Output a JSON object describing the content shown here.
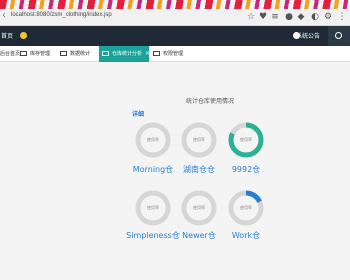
{
  "browser": {
    "url": "localhost:8080/zsm_clothing/index.jsp"
  },
  "header": {
    "brand": "首页",
    "user": "系统公告"
  },
  "tabs": [
    {
      "label": "后台首页"
    },
    {
      "label": "库存管理"
    },
    {
      "label": "数据统计"
    },
    {
      "label": "仓库统计分析",
      "active": true
    },
    {
      "label": "权限管理"
    }
  ],
  "panel": {
    "title": "统计仓库使用情况",
    "detail_link": "详细"
  },
  "warehouses": [
    {
      "name": "Morning仓",
      "label": "使用率",
      "usage": 0.0
    },
    {
      "name": "湖南仓仓",
      "label": "使用率",
      "usage": 0.0
    },
    {
      "name": "9992仓",
      "label": "使用率",
      "usage": 0.82
    },
    {
      "name": "Simpleness仓",
      "label": "使用率",
      "usage": 0.0
    },
    {
      "name": "Newer仓",
      "label": "使用率",
      "usage": 0.0
    },
    {
      "name": "Work仓",
      "label": "使用率",
      "usage": 0.18
    }
  ],
  "colors": {
    "accent": "#1ba39a",
    "ring_track": "#d6d6d6",
    "ring_fill_main": "#2bb294",
    "ring_fill_blue": "#2a7ecf"
  }
}
